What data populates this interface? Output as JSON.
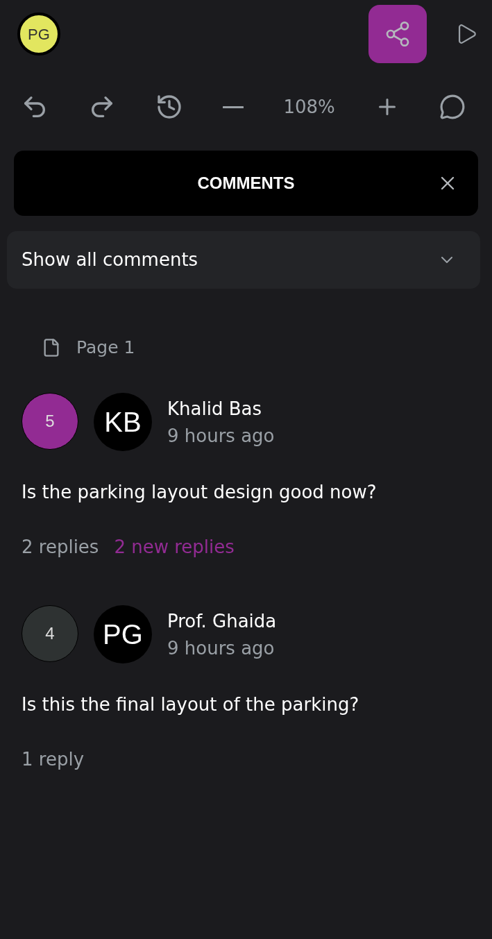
{
  "user_avatar": {
    "initials": "PG"
  },
  "toolbar": {
    "zoom": "108%"
  },
  "panel": {
    "title": "COMMENTS"
  },
  "filter": {
    "value": "Show all comments"
  },
  "page": {
    "label": "Page 1"
  },
  "comments": [
    {
      "number": "5",
      "color": "#922b93",
      "initials": "KB",
      "author": "Khalid Bas",
      "time": "9 hours ago",
      "text": "Is the parking layout design good now?",
      "replies": "2 replies",
      "new_replies": "2 new replies"
    },
    {
      "number": "4",
      "color": "#2e3232",
      "initials": "PG",
      "author": "Prof. Ghaida",
      "time": "9 hours ago",
      "text": "Is this the final layout of the parking?",
      "replies": "1 reply"
    }
  ]
}
